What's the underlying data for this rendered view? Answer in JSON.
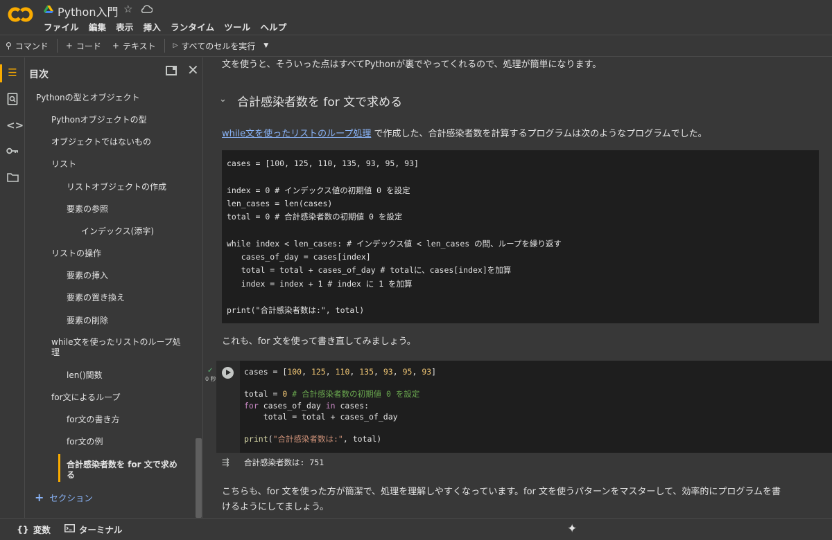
{
  "app": {
    "title": "Python入門",
    "menu": [
      "ファイル",
      "編集",
      "表示",
      "挿入",
      "ランタイム",
      "ツール",
      "ヘルプ"
    ]
  },
  "toolbar": {
    "command": "コマンド",
    "code": "コード",
    "text": "テキスト",
    "run_all": "すべてのセルを実行"
  },
  "toc": {
    "title": "目次",
    "items": [
      "Pythonの型とオブジェクト",
      "Pythonオブジェクトの型",
      "オブジェクトではないもの",
      "リスト",
      "リストオブジェクトの作成",
      "要素の参照",
      "インデックス(添字)",
      "リストの操作",
      "要素の挿入",
      "要素の置き換え",
      "要素の削除",
      "while文を使ったリストのループ処理",
      "len()関数",
      "for文によるループ",
      "for文の書き方",
      "for文の例",
      "合計感染者数を for 文で求める"
    ],
    "add_section": "セクション"
  },
  "main": {
    "intro": "文を使うと、そういった点はすべてPythonが裏でやってくれるので、処理が簡単になります。",
    "heading": "合計感染者数を for 文で求める",
    "para1_link": "while文を使ったリストのループ処理",
    "para1_rest": " で作成した、合計感染者数を計算するプログラムは次のようなプログラムでした。",
    "code_block": "cases = [100, 125, 110, 135, 93, 95, 93]\n\nindex = 0 # インデックス値の初期値 0 を設定\nlen_cases = len(cases)\ntotal = 0 # 合計感染者数の初期値 0 を設定\n\nwhile index < len_cases: # インデックス値 < len_cases の間、ループを繰り返す\n   cases_of_day = cases[index]\n   total = total + cases_of_day # totalに、cases[index]を加算\n   index = index + 1 # index に 1 を加算\n\nprint(\"合計感染者数は:\", total)",
    "para2": "これも、for 文を使って書き直してみましょう。",
    "cell_exec_time": "0 秒",
    "output": "合計感染者数は: 751",
    "para3_line1": "こちらも、for 文を使った方が簡潔で、処理を理解しやすくなっています。for 文を使うパターンをマスターして、効率的にプログラムを書",
    "para3_line2": "けるようにしてましょう。"
  },
  "statusbar": {
    "variables": "変数",
    "terminal": "ターミナル"
  },
  "colors": {
    "accent": "#f9ab00",
    "link": "#8ab4f8"
  }
}
